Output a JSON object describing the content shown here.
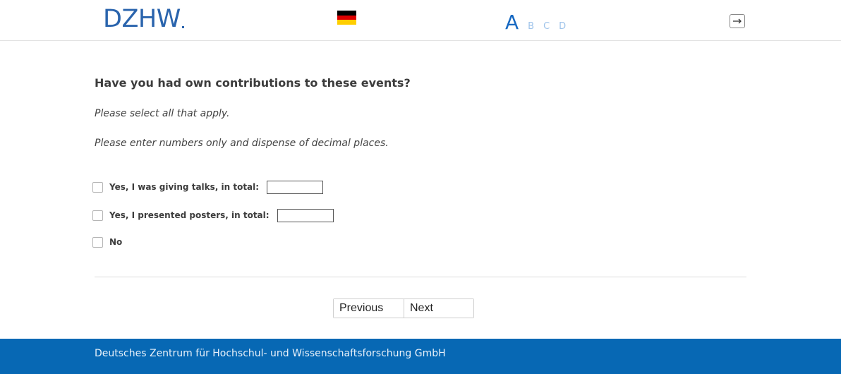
{
  "header": {
    "logo_text": "DZHW",
    "language_flag": "german-flag-icon",
    "flag_colors": [
      "#000000",
      "#dd0000",
      "#ffce00"
    ],
    "font_size_options": [
      "A",
      "B",
      "C",
      "D"
    ],
    "logout_icon": "logout-icon"
  },
  "main": {
    "question": "Have you had own contributions to these events?",
    "instruction_1": "Please select all that apply.",
    "instruction_2": "Please enter numbers only and dispense of decimal places.",
    "options": [
      {
        "label": "Yes, I was giving talks, in total:",
        "value": ""
      },
      {
        "label": "Yes, I presented posters, in total:",
        "value": ""
      },
      {
        "label": "No"
      }
    ]
  },
  "navigation": {
    "previous_label": "Previous",
    "next_label": "Next"
  },
  "footer": {
    "text": "Deutsches Zentrum für Hochschul- und Wissenschaftsforschung GmbH",
    "color": "#0768b4"
  }
}
